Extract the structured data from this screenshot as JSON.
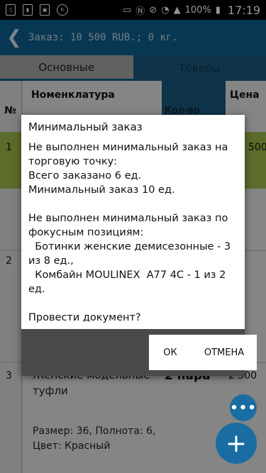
{
  "status_bar": {
    "battery_percent": "100%",
    "time": "17:19",
    "icons": [
      "battery-saver-icon",
      "sd-card-icon",
      "screenshot-icon",
      "sync-icon",
      "cast-icon",
      "nfc-icon",
      "mute-icon",
      "wifi-icon",
      "signal-icon",
      "battery-icon"
    ]
  },
  "toolbar": {
    "title": "Заказ: 10 500 RUB.; 0 кг."
  },
  "tabs": [
    {
      "label": "Основные"
    },
    {
      "label": "Товары"
    }
  ],
  "table": {
    "headers": {
      "num": "№",
      "nomenclature": "Номенклатура",
      "qty": "Кол-во",
      "price": "Цена"
    },
    "rows": [
      {
        "num": "1",
        "price": "500"
      },
      {
        "num": "2"
      },
      {
        "num": "3",
        "name": "Женские модельные туфли",
        "qty": "2 пара",
        "price": "2 500",
        "details": "Размер: 36, Полнота: 6, Цвет: Красный"
      }
    ]
  },
  "dialog": {
    "title": "Минимальный заказ",
    "body": "Не выполнен минимальный заказ на торговую точку:\nВсего заказано 6 ед.\nМинимальный заказ 10 ед.\n\nНе выполнен минимальный заказ по фокусным позициям:\n  Ботинки женские демисезонные - 3 из 8 ед.,\n  Комбайн MOULINEX  A77 4C - 1 из 2 ед.\n\nПровести документ?",
    "ok_label": "ОК",
    "cancel_label": "ОТМЕНА"
  },
  "fab": {
    "more_symbol": "•••",
    "add_symbol": "+"
  },
  "colors": {
    "primary": "#0f5f8f",
    "row_highlight": "#9dbb4a",
    "fab": "#1a6da3"
  }
}
